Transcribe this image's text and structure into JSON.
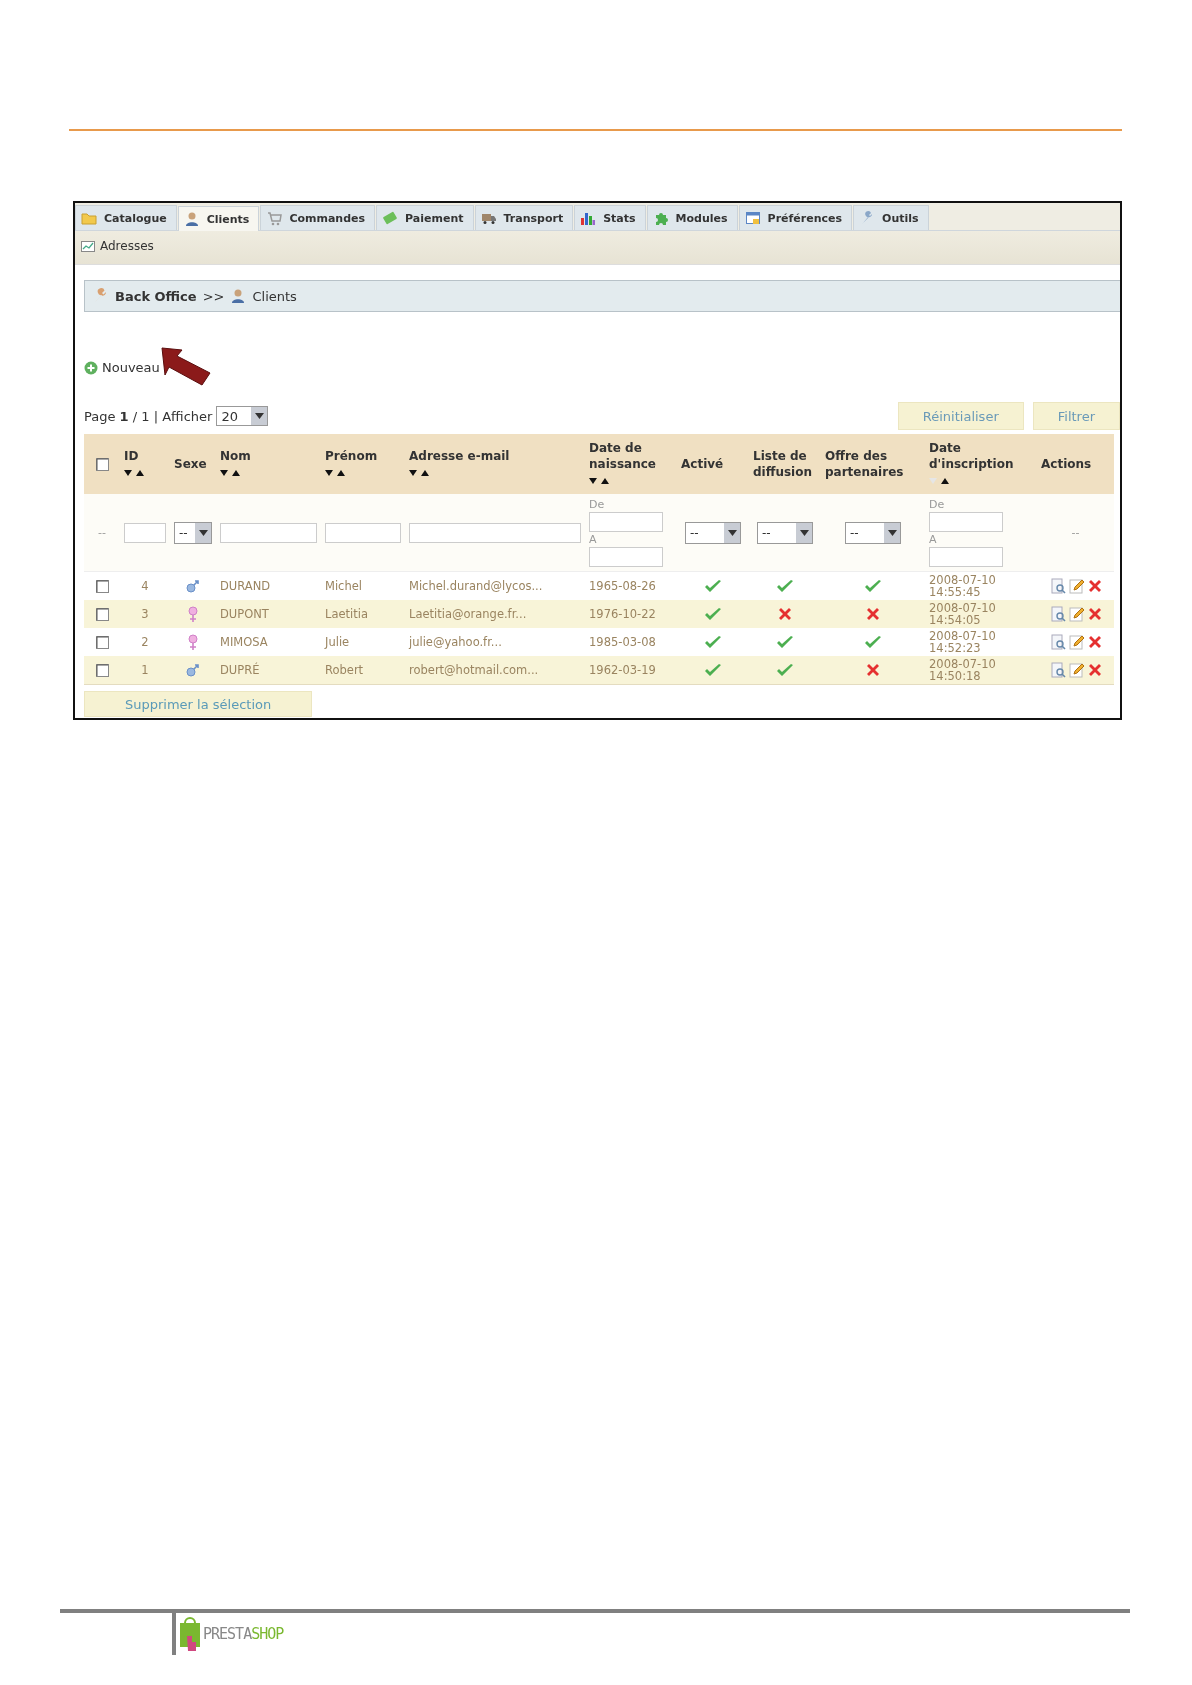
{
  "tabs": [
    {
      "label": "Catalogue",
      "selected": false
    },
    {
      "label": "Clients",
      "selected": true
    },
    {
      "label": "Commandes",
      "selected": false
    },
    {
      "label": "Paiement",
      "selected": false
    },
    {
      "label": "Transport",
      "selected": false
    },
    {
      "label": "Stats",
      "selected": false
    },
    {
      "label": "Modules",
      "selected": false
    },
    {
      "label": "Préférences",
      "selected": false
    },
    {
      "label": "Outils",
      "selected": false
    }
  ],
  "subtabs": [
    {
      "label": "Adresses"
    }
  ],
  "breadcrumb": {
    "items": [
      "Back Office",
      "Clients"
    ],
    "separator": ">>"
  },
  "new_link": {
    "label": "Nouveau"
  },
  "pagination": {
    "text": "Page **1** / 1 | Afficher",
    "per_page": "20"
  },
  "filter_buttons": [
    "Réinitialiser",
    "Filtrer"
  ],
  "table": {
    "select_all_checked": false,
    "columns": [
      {
        "kind": "select",
        "filter": {
          "kind": "dash",
          "text": "--"
        }
      },
      {
        "kind": "number",
        "label": "ID",
        "sortable": true,
        "sorted": false,
        "filter": {
          "kind": "text"
        }
      },
      {
        "kind": "gender",
        "label": "Sexe",
        "sortable": false,
        "filter": {
          "kind": "select",
          "value": "--"
        }
      },
      {
        "kind": "text",
        "label": "Nom",
        "sortable": true,
        "sorted": false,
        "filter": {
          "kind": "text"
        }
      },
      {
        "kind": "text",
        "label": "Prénom",
        "sortable": true,
        "sorted": false,
        "filter": {
          "kind": "text"
        }
      },
      {
        "kind": "text",
        "label": "Adresse e-mail",
        "sortable": true,
        "sorted": false,
        "filter": {
          "kind": "text"
        }
      },
      {
        "kind": "text",
        "label": "Date de naissance",
        "sortable": true,
        "sorted": false,
        "filter": {
          "kind": "range",
          "from": "De",
          "to": "A"
        }
      },
      {
        "kind": "bool",
        "label": "Activé",
        "sortable": false,
        "filter": {
          "kind": "select",
          "value": "--"
        }
      },
      {
        "kind": "bool",
        "label": "Liste de diffusion",
        "sortable": false,
        "filter": {
          "kind": "select",
          "value": "--"
        }
      },
      {
        "kind": "bool",
        "label": "Offre des partenaires",
        "sortable": false,
        "filter": {
          "kind": "select",
          "value": "--"
        }
      },
      {
        "kind": "text",
        "label": "Date d'inscription",
        "sortable": true,
        "sorted": true,
        "filter": {
          "kind": "range",
          "from": "De",
          "to": "A"
        }
      },
      {
        "kind": "actions",
        "label": "Actions",
        "sortable": false,
        "filter": {
          "kind": "dash",
          "text": "--"
        }
      }
    ],
    "rows": [
      {
        "checked": false,
        "id": "4",
        "female": false,
        "last_name": "DURAND",
        "first_name": "Michel",
        "email": "Michel.durand@lycos...",
        "birthday": "1965-08-26",
        "active": true,
        "newsletter": true,
        "optin": true,
        "date_add": "2008-07-10 14:55:45"
      },
      {
        "checked": false,
        "id": "3",
        "female": true,
        "last_name": "DUPONT",
        "first_name": "Laetitia",
        "email": "Laetitia@orange.fr...",
        "birthday": "1976-10-22",
        "active": true,
        "newsletter": false,
        "optin": false,
        "date_add": "2008-07-10 14:54:05"
      },
      {
        "checked": false,
        "id": "2",
        "female": true,
        "last_name": "MIMOSA",
        "first_name": "Julie",
        "email": "julie@yahoo.fr...",
        "birthday": "1985-03-08",
        "active": true,
        "newsletter": true,
        "optin": true,
        "date_add": "2008-07-10 14:52:23"
      },
      {
        "checked": false,
        "id": "1",
        "female": false,
        "last_name": "DUPRÉ",
        "first_name": "Robert",
        "email": "robert@hotmail.com...",
        "birthday": "1962-03-19",
        "active": true,
        "newsletter": true,
        "optin": false,
        "date_add": "2008-07-10 14:50:18"
      }
    ]
  },
  "bulk_action": "Supprimer la sélection",
  "footer": {
    "logo_text_1": "PRESTA",
    "logo_text_2": "SHOP"
  }
}
